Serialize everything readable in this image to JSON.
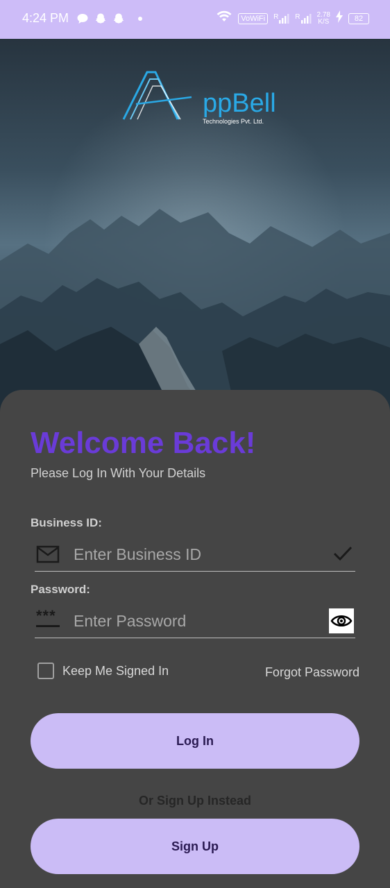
{
  "status_bar": {
    "time": "4:24 PM",
    "vowifi": "VoWiFi",
    "net_speed_value": "2.78",
    "net_speed_unit": "K/S",
    "battery": "82",
    "signal_1_label": "R",
    "signal_2_label": "R"
  },
  "logo": {
    "text": "ppBell",
    "subtitle": "Technologies Pvt. Ltd."
  },
  "login": {
    "title": "Welcome Back!",
    "subtitle": "Please Log In With Your Details",
    "business_id_label": "Business ID:",
    "business_id_placeholder": "Enter Business ID",
    "business_id_value": "",
    "password_label": "Password:",
    "password_placeholder": "Enter Password",
    "password_value": "",
    "password_icon_text": "***",
    "keep_signed_in_label": "Keep Me Signed In",
    "keep_signed_in_checked": false,
    "forgot_password": "Forgot Password",
    "login_button": "Log In",
    "or_text": "Or Sign Up Instead",
    "signup_button": "Sign Up"
  },
  "colors": {
    "status_bar": "#cdbcf8",
    "card_background": "#454545",
    "title": "#6a3bd8",
    "button": "#cbbcf6",
    "button_text": "#2a1a52",
    "logo": "#2aa9e6"
  },
  "icons": {
    "business_id_field": "envelope-icon",
    "business_id_valid": "checkmark-icon",
    "password_field": "password-asterisks-icon",
    "password_toggle": "eye-icon"
  }
}
